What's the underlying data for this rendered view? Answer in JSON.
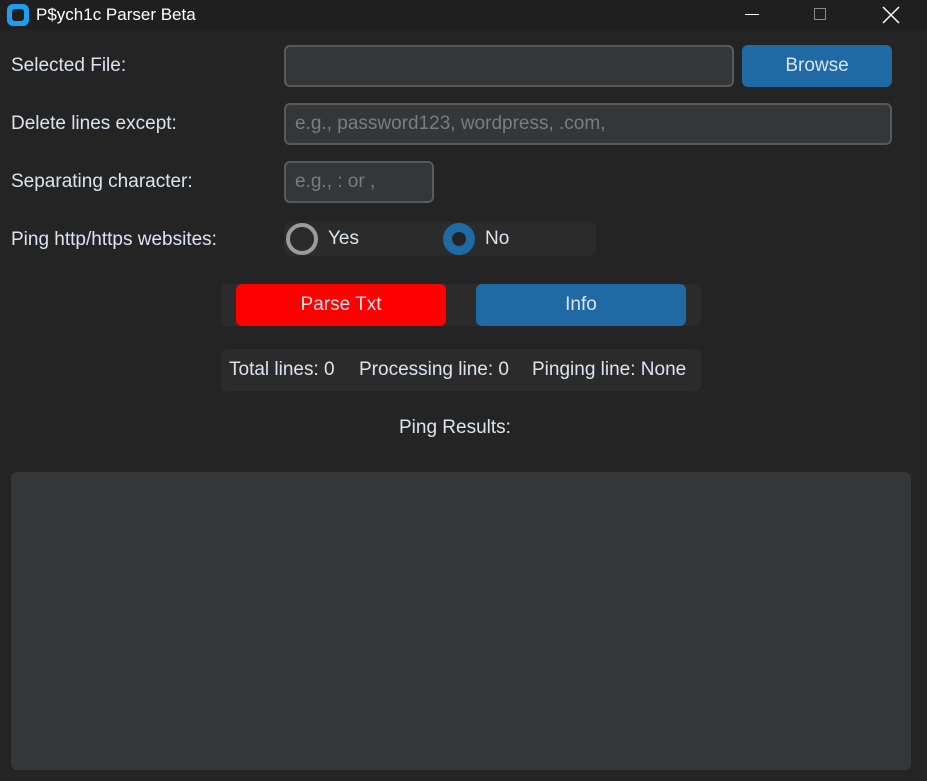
{
  "window": {
    "title": "P$ych1c Parser Beta",
    "icon": "app-icon"
  },
  "form": {
    "selected_file_label": "Selected File:",
    "selected_file_value": "",
    "browse_label": "Browse",
    "delete_lines_label": "Delete lines except:",
    "delete_lines_placeholder": "e.g., password123, wordpress, .com,",
    "delete_lines_value": "",
    "separator_label": "Separating character:",
    "separator_placeholder": "e.g., : or ,",
    "separator_value": "",
    "ping_label": "Ping http/https websites:",
    "ping_options": [
      {
        "label": "Yes",
        "selected": false
      },
      {
        "label": "No",
        "selected": true
      }
    ]
  },
  "actions": {
    "parse_label": "Parse Txt",
    "info_label": "Info"
  },
  "status": {
    "total_lines": "Total lines: 0",
    "processing_line": "Processing line: 0",
    "pinging_line": "Pinging line: None"
  },
  "results": {
    "heading": "Ping Results:",
    "content": ""
  },
  "colors": {
    "accent": "#1f6aa5",
    "parse_button": "#ff0000",
    "background": "#242424"
  }
}
